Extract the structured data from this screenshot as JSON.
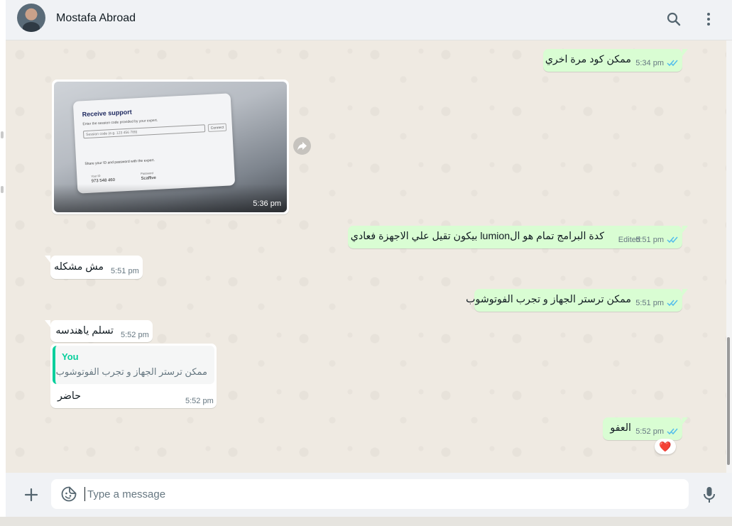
{
  "header": {
    "contact_name": "Mostafa Abroad",
    "icons": [
      "search-icon",
      "menu-icon"
    ]
  },
  "messages": [
    {
      "id": "m1",
      "direction": "outgoing",
      "text": "ممكن كود مرة اخري",
      "time": "5:34 pm",
      "status": "read"
    },
    {
      "id": "m2",
      "direction": "incoming",
      "type": "image",
      "time": "5:36 pm",
      "image": {
        "title": "Receive support",
        "hint": "Enter the session code provided by your expert.",
        "code_placeholder": "Session code (e.g. 123 456 789)",
        "connect": "Connect",
        "share_hint": "Share your ID and password with the expert.",
        "your_id_label": "Your ID",
        "your_id": "973 548 460",
        "password_label": "Password",
        "password": "Scaffive"
      }
    },
    {
      "id": "m3",
      "direction": "outgoing",
      "text": "كدة البرامج تمام هو الlumion بيكون تقيل علي الاجهزة فعادي",
      "edited_label": "Edited",
      "time": "5:51 pm",
      "status": "read"
    },
    {
      "id": "m4",
      "direction": "incoming",
      "text": "مش مشكله",
      "time": "5:51 pm"
    },
    {
      "id": "m5",
      "direction": "outgoing",
      "text": "ممكن ترستر الجهاز و تجرب الفوتوشوب",
      "time": "5:51 pm",
      "status": "read"
    },
    {
      "id": "m6",
      "direction": "incoming",
      "text": "تسلم ياهندسه",
      "time": "5:52 pm"
    },
    {
      "id": "m7",
      "direction": "incoming",
      "text": "حاضر",
      "time": "5:52 pm",
      "quote": {
        "author": "You",
        "text": "ممكن ترستر الجهاز و تجرب الفوتوشوب"
      }
    },
    {
      "id": "m8",
      "direction": "outgoing",
      "text": "العفو",
      "time": "5:52 pm",
      "status": "read",
      "reaction": "❤️"
    }
  ],
  "composer": {
    "placeholder": "Type a message",
    "icons": [
      "plus-icon",
      "sticker-icon",
      "mic-icon"
    ]
  },
  "colors": {
    "outgoing_bubble": "#d9fdd3",
    "incoming_bubble": "#ffffff",
    "read_ticks": "#53bdeb",
    "quote_accent": "#06cf9c",
    "chat_background": "#efeae2"
  }
}
